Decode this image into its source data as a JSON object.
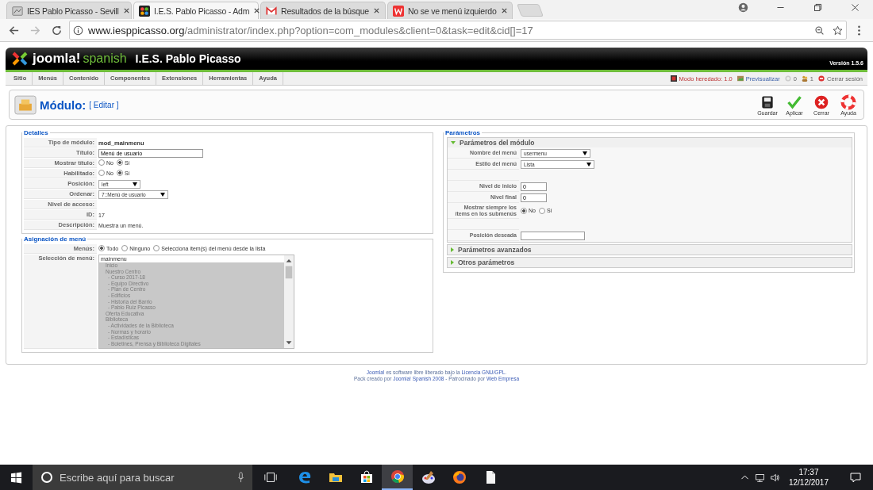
{
  "browser": {
    "tabs": [
      {
        "title": "IES Pablo Picasso - Sevill",
        "selected": false,
        "kind": "site"
      },
      {
        "title": "I.E.S. Pablo Picasso - Adm",
        "selected": true,
        "kind": "joomla"
      },
      {
        "title": "Resultados de la búsque",
        "selected": false,
        "kind": "mail"
      },
      {
        "title": "No se ve menú izquierdo",
        "selected": false,
        "kind": "web"
      }
    ],
    "url": {
      "host": "www.iesppicasso.org",
      "path": "/administrator/index.php?option=com_modules&client=0&task=edit&cid[]=17"
    }
  },
  "header": {
    "logo": "joomla!",
    "logo_sub": "spanish",
    "site_name": "I.E.S. Pablo Picasso",
    "version": "Versión 1.5.6"
  },
  "menu": {
    "items": [
      "Sitio",
      "Menús",
      "Contenido",
      "Componentes",
      "Extensiones",
      "Herramientas",
      "Ayuda"
    ],
    "status": [
      {
        "kind": "legacy",
        "text": "Modo heredado: 1.0"
      },
      {
        "kind": "preview",
        "text": "Previsualizar"
      },
      {
        "kind": "messages",
        "text": "0"
      },
      {
        "kind": "users",
        "text": "1"
      },
      {
        "kind": "logout",
        "text": "Cerrar sesión"
      }
    ]
  },
  "toolbar": {
    "title": "Módulo:",
    "subtitle": "[ Editar ]",
    "buttons": [
      {
        "kind": "save",
        "label": "Guardar"
      },
      {
        "kind": "apply",
        "label": "Aplicar"
      },
      {
        "kind": "close",
        "label": "Cerrar"
      },
      {
        "kind": "help",
        "label": "Ayuda"
      }
    ]
  },
  "details": {
    "legend": "Detalles",
    "rows": [
      {
        "label": "Tipo de módulo:",
        "kind": "name",
        "value": "mod_mainmenu"
      },
      {
        "label": "Título:",
        "kind": "input",
        "value": "Menú de usuario"
      },
      {
        "label": "Mostrar título:",
        "kind": "radio",
        "options": [
          {
            "label": "No",
            "selected": false
          },
          {
            "label": "Sí",
            "selected": true
          }
        ]
      },
      {
        "label": "Habilitado:",
        "kind": "radio",
        "options": [
          {
            "label": "No",
            "selected": false
          },
          {
            "label": "Sí",
            "selected": true
          }
        ]
      },
      {
        "label": "Posición:",
        "kind": "combo",
        "value": "left"
      },
      {
        "label": "Ordenar:",
        "kind": "select",
        "value": "7::Menú de usuario"
      },
      {
        "label": "Nivel de acceso:",
        "kind": "empty"
      },
      {
        "label": "ID:",
        "kind": "text",
        "value": "17"
      },
      {
        "label": "Descripción:",
        "kind": "text",
        "value": "Muestra un menú."
      }
    ]
  },
  "menu_assignment": {
    "legend": "Asignación de menú",
    "menus_label": "Menús:",
    "menus_options": [
      {
        "label": "Todo",
        "selected": true
      },
      {
        "label": "Ninguno",
        "selected": false
      },
      {
        "label": "Selecciona item(s) del menú desde la lista",
        "selected": false
      }
    ],
    "selection_label": "Selección de menú:",
    "list": {
      "header": "mainmenu",
      "items": [
        {
          "label": "Inicio"
        },
        {
          "label": "Nuestro Centro",
          "children": [
            {
              "label": "- Curso 2017-18"
            },
            {
              "label": "- Equipo Directivo"
            },
            {
              "label": "- Plan de Centro"
            },
            {
              "label": "- Edificios"
            },
            {
              "label": "- Historia del Barrio"
            },
            {
              "label": "- Pablo Ruiz Picasso"
            }
          ]
        },
        {
          "label": "Oferta Educativa"
        },
        {
          "label": "Biblioteca",
          "children": [
            {
              "label": "- Actividades de la Biblioteca"
            },
            {
              "label": "- Normas y horario"
            },
            {
              "label": "- Estadísticas"
            },
            {
              "label": "- Boletines, Prensa y Biblioteca Digitales"
            }
          ]
        }
      ]
    }
  },
  "parameters": {
    "legend": "Parámetros",
    "panels": [
      {
        "title": "Parámetros del módulo",
        "expanded": true,
        "rows": [
          {
            "label": "Nombre del menú",
            "kind": "select",
            "value": "usermenu"
          },
          {
            "label": "Estilo del menú",
            "kind": "select",
            "value": "Lista"
          },
          {
            "kind": "spacer"
          },
          {
            "label": "Nivel de inicio",
            "kind": "input",
            "value": "0"
          },
          {
            "label": "Nivel final",
            "kind": "input",
            "value": "0"
          },
          {
            "label": "Mostrar siempre los ítems en los submenús",
            "kind": "radio",
            "options": [
              {
                "label": "No",
                "selected": true
              },
              {
                "label": "Sí",
                "selected": false
              }
            ]
          },
          {
            "kind": "spacer"
          },
          {
            "label": "Posición deseada",
            "kind": "input",
            "value": ""
          }
        ]
      },
      {
        "title": "Parámetros avanzados",
        "expanded": false
      },
      {
        "title": "Otros parámetros",
        "expanded": false
      }
    ]
  },
  "footer": {
    "line1": [
      {
        "text": "Joomla!",
        "link": true
      },
      {
        "text": " es software libre liberado bajo la "
      },
      {
        "text": "Licencia GNU/GPL",
        "link": true
      },
      {
        "text": "."
      }
    ],
    "line2": [
      {
        "text": "Pack creado por "
      },
      {
        "text": "Joomla! Spanish 2008",
        "link": true
      },
      {
        "text": " - Patrocinado por "
      },
      {
        "text": "Web Empresa",
        "link": true
      }
    ]
  },
  "taskbar": {
    "search_placeholder": "Escribe aquí para buscar",
    "apps": [
      {
        "kind": "edge",
        "active": false
      },
      {
        "kind": "explorer",
        "active": false
      },
      {
        "kind": "store",
        "active": false
      },
      {
        "kind": "chrome",
        "active": true
      },
      {
        "kind": "paint",
        "active": false
      },
      {
        "kind": "firefox",
        "active": false
      },
      {
        "kind": "file",
        "active": false
      }
    ],
    "time": "17:37",
    "date": "12/12/2017"
  }
}
